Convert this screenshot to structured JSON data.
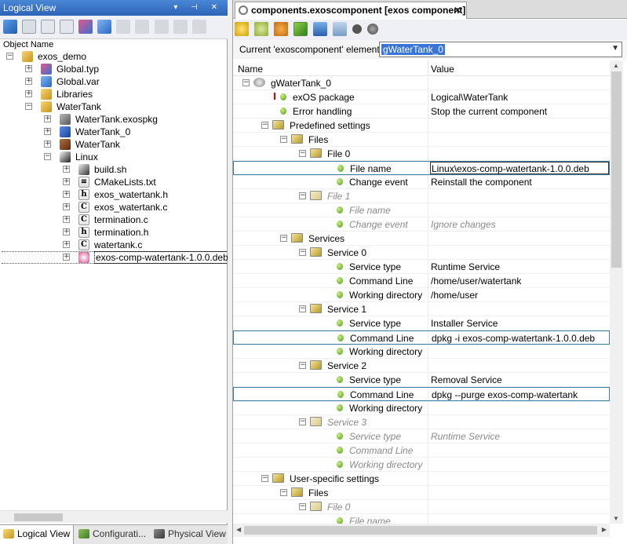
{
  "left_panel": {
    "title": "Logical View",
    "title_buttons": "▾ ⊣ ✕",
    "column_header": "Object Name",
    "tree": [
      {
        "label": "exos_demo",
        "icon": "project-folder-icon",
        "depth": 0,
        "expander": "minus"
      },
      {
        "label": "Global.typ",
        "icon": "type-file-icon",
        "depth": 1,
        "expander": "plus"
      },
      {
        "label": "Global.var",
        "icon": "var-file-icon",
        "depth": 1,
        "expander": "plus"
      },
      {
        "label": "Libraries",
        "icon": "folder-icon",
        "depth": 1,
        "expander": "plus"
      },
      {
        "label": "WaterTank",
        "icon": "folder-icon",
        "depth": 1,
        "expander": "minus"
      },
      {
        "label": "WaterTank.exospkg",
        "icon": "exospkg-icon",
        "depth": 2,
        "expander": "plus"
      },
      {
        "label": "WaterTank_0",
        "icon": "exos-component-icon",
        "depth": 2,
        "expander": "plus"
      },
      {
        "label": "WaterTank",
        "icon": "task-icon",
        "depth": 2,
        "expander": "plus"
      },
      {
        "label": "Linux",
        "icon": "linux-icon",
        "depth": 2,
        "expander": "minus"
      },
      {
        "label": "build.sh",
        "icon": "shell-script-icon",
        "depth": 3,
        "expander": "plus"
      },
      {
        "label": "CMakeLists.txt",
        "icon": "text-file-icon",
        "depth": 3,
        "expander": "plus"
      },
      {
        "label": "exos_watertank.h",
        "icon": "header-file-icon",
        "depth": 3,
        "expander": "plus"
      },
      {
        "label": "exos_watertank.c",
        "icon": "c-file-icon",
        "depth": 3,
        "expander": "plus"
      },
      {
        "label": "termination.c",
        "icon": "c-file-icon",
        "depth": 3,
        "expander": "plus"
      },
      {
        "label": "termination.h",
        "icon": "header-file-icon",
        "depth": 3,
        "expander": "plus"
      },
      {
        "label": "watertank.c",
        "icon": "c-file-icon",
        "depth": 3,
        "expander": "plus"
      },
      {
        "label": "exos-comp-watertank-1.0.0.deb",
        "icon": "deb-package-icon",
        "depth": 3,
        "expander": "plus",
        "selected": true
      }
    ],
    "tabs": [
      {
        "label": "Logical View",
        "active": true
      },
      {
        "label": "Configurati...",
        "active": false
      },
      {
        "label": "Physical View",
        "active": false
      }
    ]
  },
  "editor": {
    "tab_title": "components.exoscomponent [exos component]",
    "tab_close": "✕",
    "current_label": "Current 'exoscomponent' element:",
    "current_value": "gWaterTank_0",
    "columns": {
      "name": "Name",
      "value": "Value"
    },
    "rows": [
      {
        "name": "gWaterTank_0",
        "value": "",
        "depth": 0,
        "expander": "minus",
        "icon": "component-icon"
      },
      {
        "name": "exOS package",
        "value": "Logical\\WaterTank",
        "depth": 1,
        "icon": "dot",
        "req": true
      },
      {
        "name": "Error handling",
        "value": "Stop the current component",
        "depth": 1,
        "icon": "dot"
      },
      {
        "name": "Predefined settings",
        "value": "",
        "depth": 1,
        "expander": "minus",
        "icon": "settings-icon"
      },
      {
        "name": "Files",
        "value": "",
        "depth": 2,
        "expander": "minus",
        "icon": "settings-icon"
      },
      {
        "name": "File 0",
        "value": "",
        "depth": 3,
        "expander": "minus",
        "icon": "settings-icon"
      },
      {
        "name": "File name",
        "value": "Linux\\exos-comp-watertank-1.0.0.deb",
        "depth": 4,
        "icon": "dot",
        "highlight": true,
        "edit": true
      },
      {
        "name": "Change event",
        "value": "Reinstall the component",
        "depth": 4,
        "icon": "dot"
      },
      {
        "name": "File 1",
        "value": "",
        "depth": 3,
        "expander": "minus",
        "icon": "settings-icon",
        "dim": true
      },
      {
        "name": "File name",
        "value": "",
        "depth": 4,
        "icon": "dot",
        "dim": true
      },
      {
        "name": "Change event",
        "value": "Ignore changes",
        "depth": 4,
        "icon": "dot",
        "dim": true
      },
      {
        "name": "Services",
        "value": "",
        "depth": 2,
        "expander": "minus",
        "icon": "settings-icon"
      },
      {
        "name": "Service 0",
        "value": "",
        "depth": 3,
        "expander": "minus",
        "icon": "settings-icon"
      },
      {
        "name": "Service type",
        "value": "Runtime Service",
        "depth": 4,
        "icon": "dot"
      },
      {
        "name": "Command Line",
        "value": "/home/user/watertank",
        "depth": 4,
        "icon": "dot"
      },
      {
        "name": "Working directory",
        "value": "/home/user",
        "depth": 4,
        "icon": "dot"
      },
      {
        "name": "Service 1",
        "value": "",
        "depth": 3,
        "expander": "minus",
        "icon": "settings-icon"
      },
      {
        "name": "Service type",
        "value": "Installer Service",
        "depth": 4,
        "icon": "dot"
      },
      {
        "name": "Command Line",
        "value": "dpkg -i exos-comp-watertank-1.0.0.deb",
        "depth": 4,
        "icon": "dot",
        "highlight": true
      },
      {
        "name": "Working directory",
        "value": "",
        "depth": 4,
        "icon": "dot"
      },
      {
        "name": "Service 2",
        "value": "",
        "depth": 3,
        "expander": "minus",
        "icon": "settings-icon"
      },
      {
        "name": "Service type",
        "value": "Removal Service",
        "depth": 4,
        "icon": "dot"
      },
      {
        "name": "Command Line",
        "value": "dpkg --purge exos-comp-watertank",
        "depth": 4,
        "icon": "dot",
        "highlight": true
      },
      {
        "name": "Working directory",
        "value": "",
        "depth": 4,
        "icon": "dot"
      },
      {
        "name": "Service 3",
        "value": "",
        "depth": 3,
        "expander": "minus",
        "icon": "settings-icon",
        "dim": true
      },
      {
        "name": "Service type",
        "value": "Runtime Service",
        "depth": 4,
        "icon": "dot",
        "dim": true
      },
      {
        "name": "Command Line",
        "value": "",
        "depth": 4,
        "icon": "dot",
        "dim": true
      },
      {
        "name": "Working directory",
        "value": "",
        "depth": 4,
        "icon": "dot",
        "dim": true
      },
      {
        "name": "User-specific settings",
        "value": "",
        "depth": 1,
        "expander": "minus",
        "icon": "settings-icon"
      },
      {
        "name": "Files",
        "value": "",
        "depth": 2,
        "expander": "minus",
        "icon": "settings-icon"
      },
      {
        "name": "File 0",
        "value": "",
        "depth": 3,
        "expander": "minus",
        "icon": "settings-icon",
        "dim": true
      },
      {
        "name": "File name",
        "value": "",
        "depth": 4,
        "icon": "dot",
        "dim": true
      }
    ]
  },
  "colors": {
    "title_bar": "#2d63b8",
    "selection": "#3875d7",
    "highlight_border": "#3d7ea6",
    "dim_text": "#8a8a8a"
  }
}
